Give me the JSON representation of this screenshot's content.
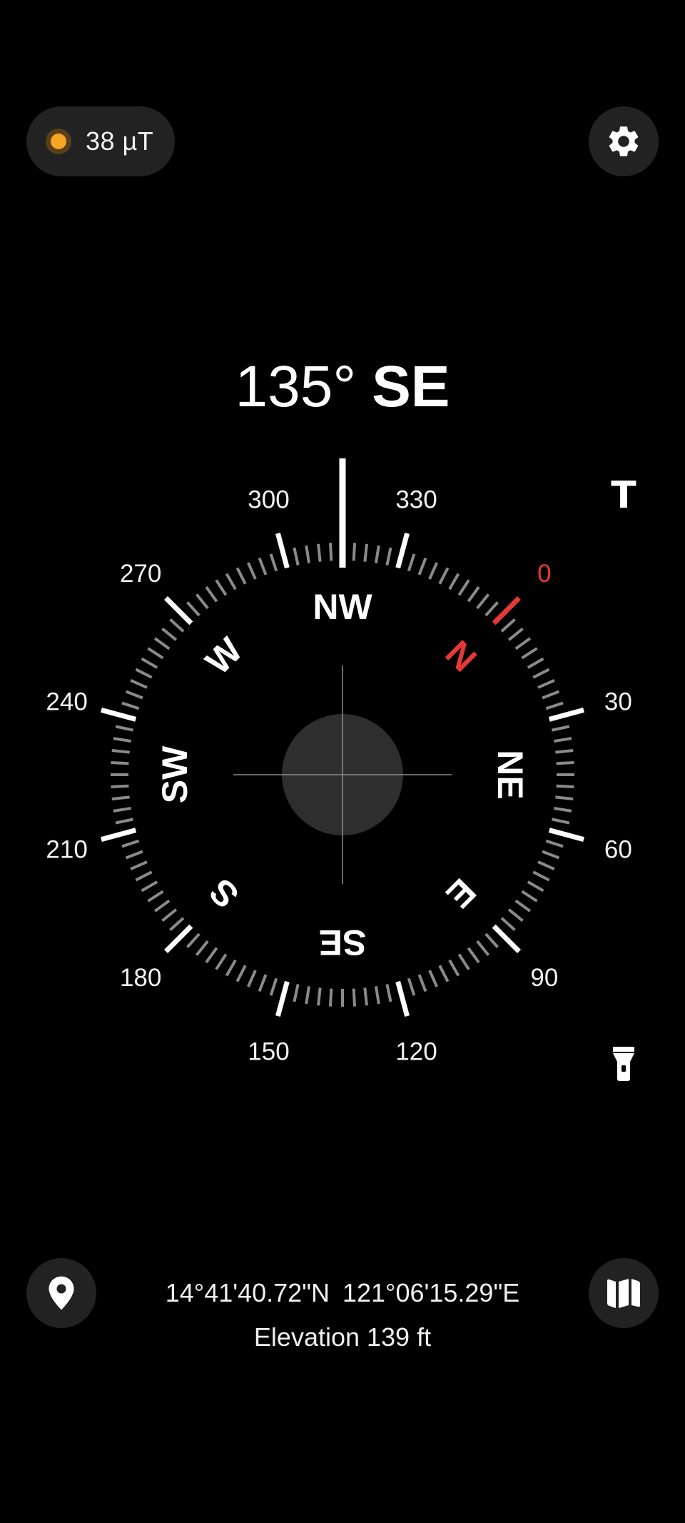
{
  "magnetic_field": {
    "value": "38 µT",
    "indicator_color": "#f5a623"
  },
  "heading": {
    "degrees": "135°",
    "direction": "SE",
    "bearing_value": 135
  },
  "compass": {
    "degree_labels": [
      "0",
      "30",
      "60",
      "90",
      "120",
      "150",
      "180",
      "210",
      "240",
      "270",
      "300",
      "330"
    ],
    "cardinals": [
      "N",
      "NE",
      "E",
      "SE",
      "S",
      "SW",
      "W",
      "NW"
    ],
    "north_color": "#e53935",
    "major_tick_color": "#ffffff",
    "minor_tick_color": "#8a8a8a"
  },
  "location": {
    "latitude": "14°41'40.72\"N",
    "longitude": "121°06'15.29\"E",
    "elevation": "Elevation 139 ft"
  },
  "icons": {
    "settings": "gear-icon",
    "true_north": "T",
    "flashlight": "flashlight-icon",
    "location": "location-pin-icon",
    "map": "map-icon"
  }
}
